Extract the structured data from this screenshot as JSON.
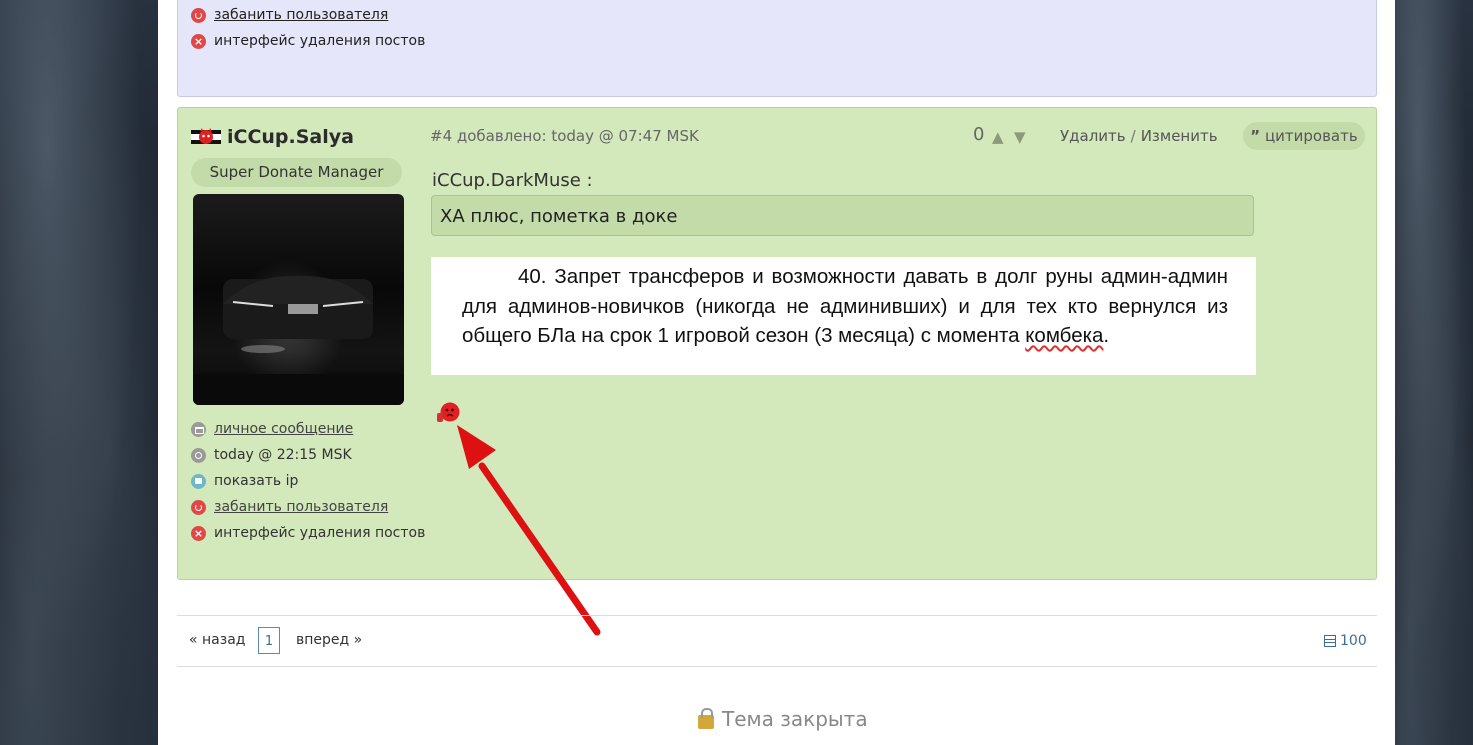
{
  "prev_post": {
    "ban_label": "забанить пользователя",
    "delete_label": "интерфейс удаления постов"
  },
  "post": {
    "author": "iCCup.Salya",
    "role": "Super Donate Manager",
    "meta": "#4 добавлено: today @ 07:47 MSK",
    "score": "0",
    "delete_label": "Удалить",
    "separator": "/",
    "edit_label": "Изменить",
    "quote_label": "цитировать",
    "quote_author": "iCCup.DarkMuse :",
    "quote_text": "ХА плюс, пометка в доке",
    "doc_text_main": "40. Запрет трансферов и возможности давать в долг руны админ-админ для админов-новичков (никогда не админивших) и для тех кто вернулся из общего БЛа на срок 1 игровой сезон (3 месяца) с момента",
    "doc_text_marked": "комбека",
    "doc_text_end": ".",
    "sidebar": {
      "pm_label": "личное сообщение",
      "last_seen": "today @ 22:15 MSK",
      "show_ip_label": "показать ip",
      "ban_label": "забанить пользователя",
      "delete_label": "интерфейс удаления постов"
    }
  },
  "pagination": {
    "prev_label": "« назад",
    "current_page": "1",
    "next_label": "вперед »",
    "per_page": "100"
  },
  "topic_status": "Тема закрыта",
  "colors": {
    "post_bg": "#d3e8bb",
    "prev_post_bg": "#e6e6fa",
    "arrow": "#dd1111"
  }
}
